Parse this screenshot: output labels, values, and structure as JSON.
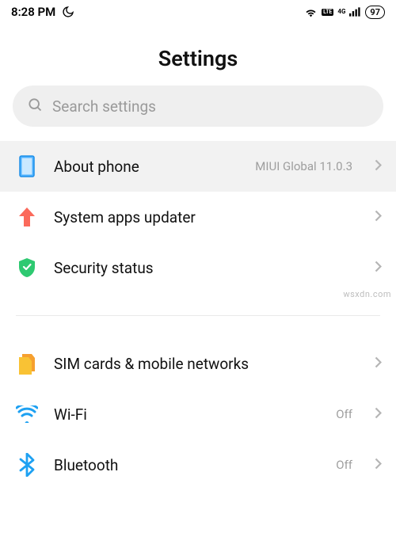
{
  "status_bar": {
    "time": "8:28 PM",
    "network_label": "4G",
    "lte_label": "LTE",
    "battery": "97"
  },
  "header": {
    "title": "Settings"
  },
  "search": {
    "placeholder": "Search settings"
  },
  "items": [
    {
      "id": "about-phone",
      "label": "About phone",
      "detail": "MIUI Global 11.0.3",
      "highlighted": true
    },
    {
      "id": "system-apps-updater",
      "label": "System apps updater",
      "detail": ""
    },
    {
      "id": "security-status",
      "label": "Security status",
      "detail": ""
    },
    {
      "id": "sim-cards",
      "label": "SIM cards & mobile networks",
      "detail": ""
    },
    {
      "id": "wifi",
      "label": "Wi-Fi",
      "detail": "Off"
    },
    {
      "id": "bluetooth",
      "label": "Bluetooth",
      "detail": "Off"
    }
  ],
  "watermark": "wsxdn.com"
}
